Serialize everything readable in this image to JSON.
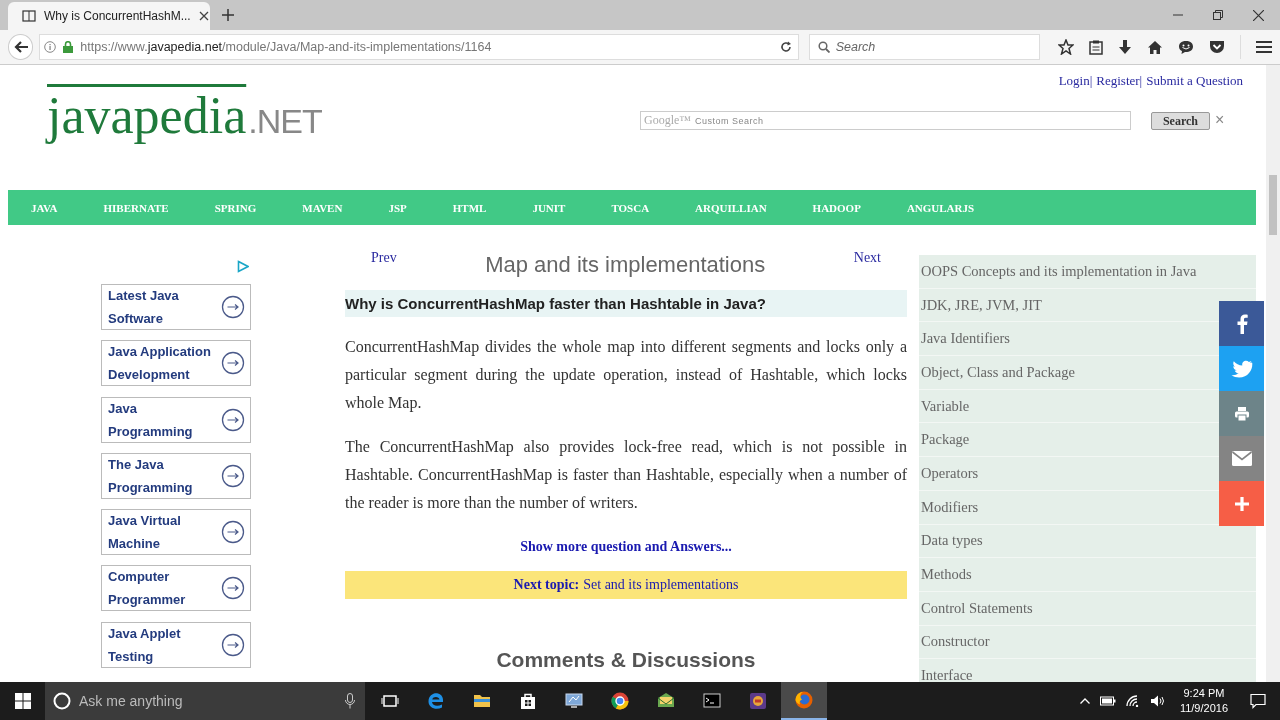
{
  "browser": {
    "tab_title": "Why is ConcurrentHashM...",
    "url_prefix": "https://www.",
    "url_host": "javapedia.net",
    "url_path": "/module/Java/Map-and-its-implementations/1164",
    "search_placeholder": "Search"
  },
  "header": {
    "links": [
      "Login|",
      "Register|",
      "Submit a Question"
    ]
  },
  "logo": {
    "name": "javapedia",
    "suffix": ".NET"
  },
  "site_search": {
    "brand": "Google™",
    "placeholder": "Custom Search",
    "button": "Search",
    "clear": "×"
  },
  "menu": [
    "JAVA",
    "HIBERNATE",
    "SPRING",
    "MAVEN",
    "JSP",
    "HTML",
    "JUNIT",
    "TOSCA",
    "ARQUILLIAN",
    "HADOOP",
    "ANGULARJS"
  ],
  "ads": [
    "Latest Java Software",
    "Java Application Development",
    "Java Programming",
    "The Java Programming",
    "Java Virtual Machine",
    "Computer Programmer",
    "Java Applet Testing"
  ],
  "article": {
    "prev": "Prev",
    "title": "Map and its implementations",
    "next": "Next",
    "question": "Why is ConcurrentHashMap faster than Hashtable in Java?",
    "paragraphs": [
      "ConcurrentHashMap divides the whole map into different segments and locks only a particular segment during the update operation, instead of Hashtable, which locks whole Map.",
      "The ConcurrentHashMap also provides lock-free read, which is not possible in Hashtable. ConcurrentHashMap is faster than Hashtable, especially when a number of the reader is more than the number of writers."
    ],
    "more_link": "Show more question and Answers...",
    "next_topic_label": "Next topic:",
    "next_topic_link": "Set and its implementations",
    "comments_heading": "Comments & Discussions"
  },
  "topics": [
    "OOPS Concepts and its implementation in Java",
    "JDK, JRE, JVM, JIT",
    "Java Identifiers",
    "Object, Class and Package",
    "Variable",
    "Package",
    "Operators",
    "Modifiers",
    "Data types",
    "Methods",
    "Control Statements",
    "Constructor",
    "Interface"
  ],
  "share": [
    {
      "kind": "facebook",
      "color": "#3b5998"
    },
    {
      "kind": "twitter",
      "color": "#1da1f2"
    },
    {
      "kind": "print",
      "color": "#6d8489"
    },
    {
      "kind": "email",
      "color": "#848484"
    },
    {
      "kind": "more",
      "color": "#f65e46"
    }
  ],
  "taskbar": {
    "search_placeholder": "Ask me anything",
    "apps": [
      {
        "kind": "taskview",
        "selected": false
      },
      {
        "kind": "edge",
        "selected": false
      },
      {
        "kind": "folder",
        "selected": false
      },
      {
        "kind": "store",
        "selected": false
      },
      {
        "kind": "monitor",
        "selected": false
      },
      {
        "kind": "chrome",
        "selected": false
      },
      {
        "kind": "mail",
        "selected": false
      },
      {
        "kind": "terminal",
        "selected": false
      },
      {
        "kind": "game",
        "selected": false
      },
      {
        "kind": "firefox",
        "selected": true
      }
    ],
    "time": "9:24 PM",
    "date": "11/9/2016"
  }
}
